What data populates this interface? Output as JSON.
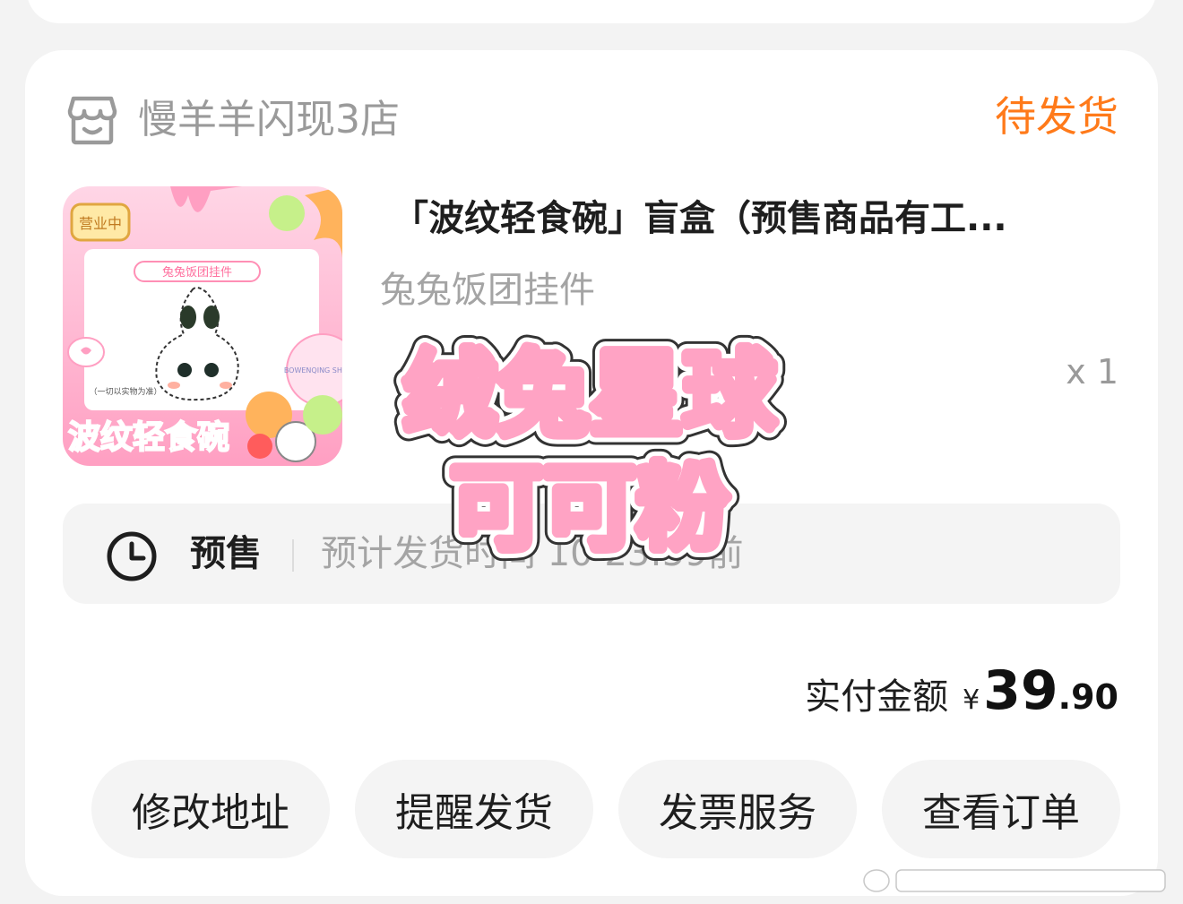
{
  "shop": {
    "name": "慢羊羊闪现3店",
    "status": "待发货",
    "status_color": "#ff7a1a"
  },
  "product": {
    "title": "「波纹轻食碗」盲盒（预售商品有工...",
    "spec": "兔兔饭团挂件",
    "quantity": "x 1",
    "image": {
      "badge": "营业中",
      "label": "兔兔饭团挂件",
      "tag": "BOWENQING SHIWAN",
      "note": "（一切以实物为准）",
      "brand": "波纹轻食碗"
    }
  },
  "presale": {
    "label": "预售",
    "text": "预计发货时间 10 23:59前",
    "visible_text": "预计发                  10 23:59前"
  },
  "payment": {
    "label": "实付金额",
    "currency": "¥",
    "amount_int": "39",
    "amount_dec": ".90"
  },
  "actions": [
    {
      "label": "修改地址"
    },
    {
      "label": "提醒发货"
    },
    {
      "label": "发票服务"
    },
    {
      "label": "查看订单"
    }
  ],
  "sticker": {
    "line1": "绒兔星球",
    "line2": "可可粉",
    "color": "#ffa3c4"
  },
  "icons": {
    "shop": "shop-icon",
    "clock": "clock-icon"
  }
}
